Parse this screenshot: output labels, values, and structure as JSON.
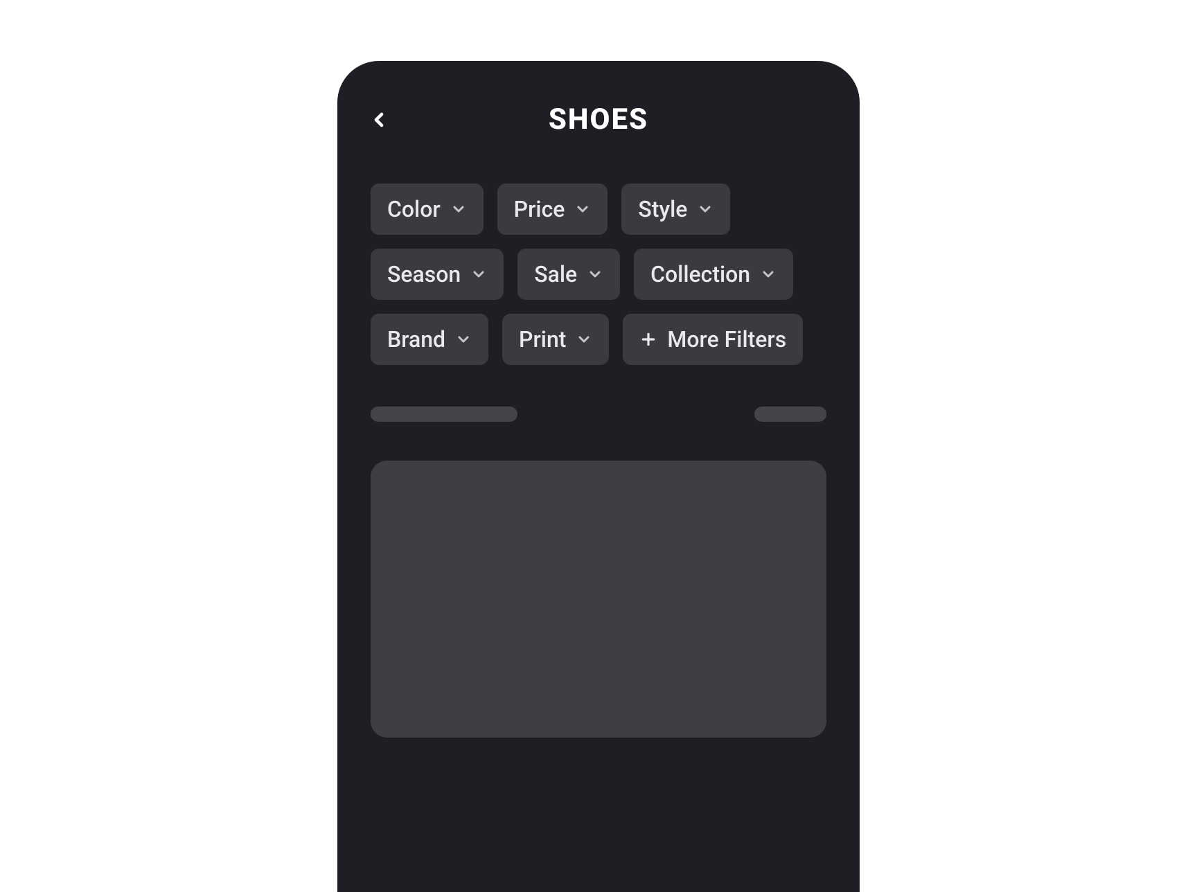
{
  "header": {
    "title": "SHOES"
  },
  "filters": [
    {
      "label": "Color"
    },
    {
      "label": "Price"
    },
    {
      "label": "Style"
    },
    {
      "label": "Season"
    },
    {
      "label": "Sale"
    },
    {
      "label": "Collection"
    },
    {
      "label": "Brand"
    },
    {
      "label": "Print"
    }
  ],
  "moreFilters": {
    "label": "More Filters"
  }
}
